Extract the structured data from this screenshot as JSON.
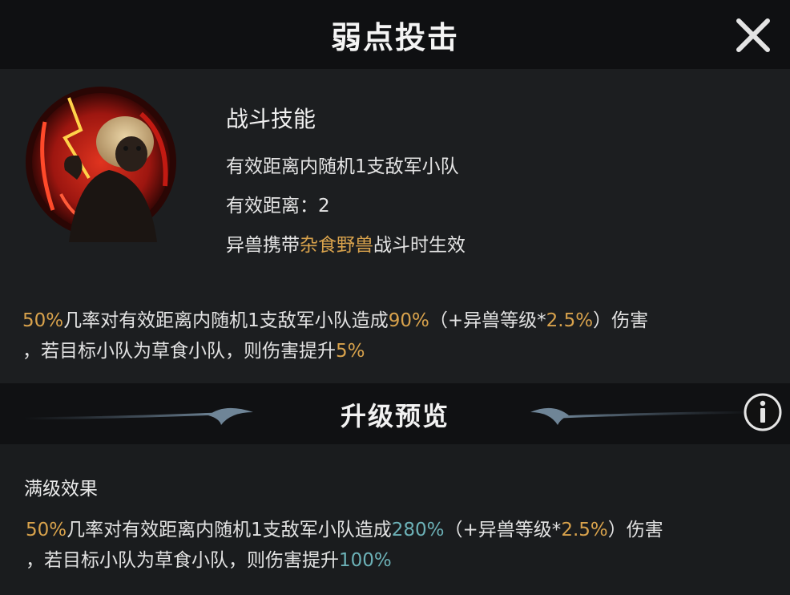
{
  "header": {
    "title": "弱点投击"
  },
  "skill": {
    "type": "战斗技能",
    "line1": "有效距离内随机1支敌军小队",
    "line2": "有效距离：2",
    "line3_prefix": "异兽携带",
    "line3_highlight": "杂食野兽",
    "line3_suffix": "战斗时生效"
  },
  "current_effect": {
    "p1": "50%",
    "t1": "几率对有效距离内随机1支敌军小队造成",
    "p2": "90%",
    "t2": "（+异兽等级*",
    "p3": "2.5%",
    "t3": "）伤害",
    "t4": "，若目标小队为草食小队，则伤害提升",
    "p4": "5%"
  },
  "preview": {
    "title": "升级预览",
    "max_label": "满级效果"
  },
  "max_effect": {
    "p1": "50%",
    "t1": "几率对有效距离内随机1支敌军小队造成",
    "p2": "280%",
    "t2": "（+异兽等级*",
    "p3": "2.5%",
    "t3": "）伤害",
    "t4": "，若目标小队为草食小队，则伤害提升",
    "p4": "100%"
  },
  "icons": {
    "close": "close-icon",
    "info": "info-icon",
    "portrait": "monkey-portrait"
  },
  "colors": {
    "highlight_gold": "#d8a24c",
    "highlight_teal": "#6cb1b7",
    "background": "#1c1e20"
  }
}
